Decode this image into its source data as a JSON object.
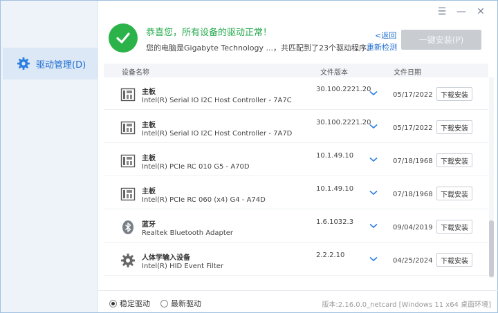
{
  "window": {
    "controls": {
      "menu": "☰",
      "minimize": "—",
      "close": "✕"
    }
  },
  "sidebar": {
    "items": [
      {
        "label": "驱动管理(D)",
        "icon": "gear-icon",
        "active": true
      }
    ]
  },
  "header": {
    "title": "恭喜您，所有设备的驱动正常！",
    "subtitle": "您的电脑是Gigabyte Technology ...，共匹配到了23个驱动程序。",
    "back_link": "<返回",
    "rescan_link": "重新检测",
    "install_all": "一键安装(P)"
  },
  "table": {
    "columns": {
      "name": "设备名称",
      "version": "文件版本",
      "date": "文件日期"
    },
    "rows": [
      {
        "category": "主板",
        "name": "Intel(R) Serial IO I2C Host Controller - 7A7C",
        "version": "30.100.2221.20",
        "date": "05/17/2022",
        "action": "下载安装",
        "icon": "motherboard-icon"
      },
      {
        "category": "主板",
        "name": "Intel(R) Serial IO I2C Host Controller - 7A7D",
        "version": "30.100.2221.20",
        "date": "05/17/2022",
        "action": "下载安装",
        "icon": "motherboard-icon"
      },
      {
        "category": "主板",
        "name": "Intel(R) PCIe RC 010 G5 - A70D",
        "version": "10.1.49.10",
        "date": "07/18/1968",
        "action": "下载安装",
        "icon": "motherboard-icon"
      },
      {
        "category": "主板",
        "name": "Intel(R) PCIe RC 060 (x4) G4 - A74D",
        "version": "10.1.49.10",
        "date": "07/18/1968",
        "action": "下载安装",
        "icon": "motherboard-icon"
      },
      {
        "category": "蓝牙",
        "name": "Realtek Bluetooth Adapter",
        "version": "1.6.1032.3",
        "date": "09/04/2019",
        "action": "下载安装",
        "icon": "bluetooth-icon"
      },
      {
        "category": "人体学输入设备",
        "name": "Intel(R) HID Event Filter",
        "version": "2.2.2.10",
        "date": "04/25/2024",
        "action": "下载安装",
        "icon": "gear-icon"
      }
    ]
  },
  "footer": {
    "radio_stable": "稳定驱动",
    "radio_latest": "最新驱动",
    "selected": "stable",
    "version": "版本:2.16.0.0_netcard [Windows 11 x64 桌面环境]"
  },
  "colors": {
    "accent": "#1f6fd1",
    "success": "#2bb34a",
    "disabled": "#c9cdd2"
  }
}
